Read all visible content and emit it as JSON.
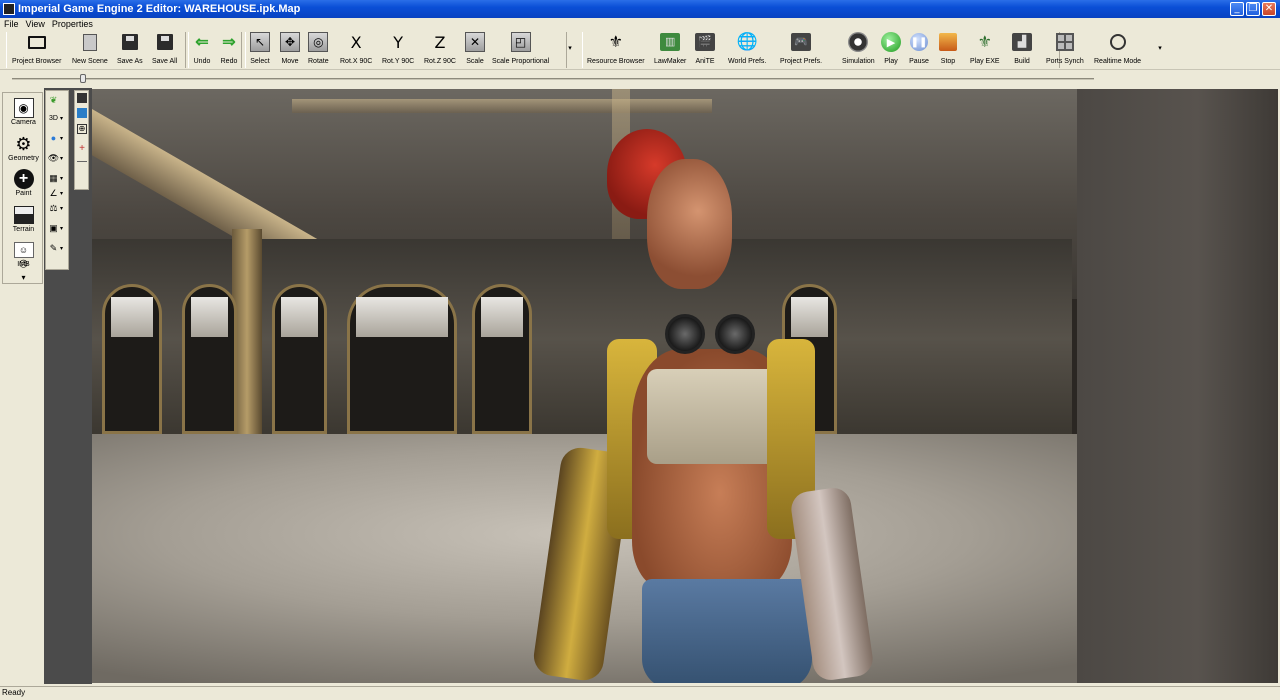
{
  "window": {
    "title": "Imperial Game Engine 2 Editor: WAREHOUSE.ipk.Map",
    "minimize": "_",
    "restore": "❐",
    "close": "✕"
  },
  "menu": [
    "File",
    "View",
    "Properties"
  ],
  "toolbar": {
    "project_browser": "Project Browser",
    "new_scene": "New Scene",
    "save_as": "Save As",
    "save_all": "Save All",
    "undo": "Undo",
    "redo": "Redo",
    "select": "Select",
    "move": "Move",
    "rotate": "Rotate",
    "rot_x": "Rot.X 90C",
    "rot_y": "Rot.Y 90C",
    "rot_z": "Rot.Z 90C",
    "scale": "Scale",
    "scale_proportional": "Scale Proportional",
    "resource_browser": "Resource Browser",
    "lawmaker": "LawMaker",
    "anite": "AniTE",
    "world_prefs": "World Prefs.",
    "project_prefs": "Project Prefs.",
    "simulation": "Simulation",
    "play": "Play",
    "pause": "Pause",
    "stop": "Stop",
    "play_exe": "Play EXE",
    "build": "Build",
    "ports_synch": "Ports Synch",
    "realtime_mode": "Realtime Mode",
    "rot_glyphs": {
      "x": "X",
      "y": "Y",
      "z": "Z"
    }
  },
  "slider": {
    "value_fraction": 0.066
  },
  "left_panel": {
    "camera": "Camera",
    "geometry": "Geometry",
    "paint": "Paint",
    "terrain": "Terrain",
    "imb": "IMB",
    "paint_glyph": "+",
    "expand_glyph": "▾"
  },
  "tools": {
    "view_mode": "3D"
  },
  "status": {
    "text": "Ready"
  }
}
